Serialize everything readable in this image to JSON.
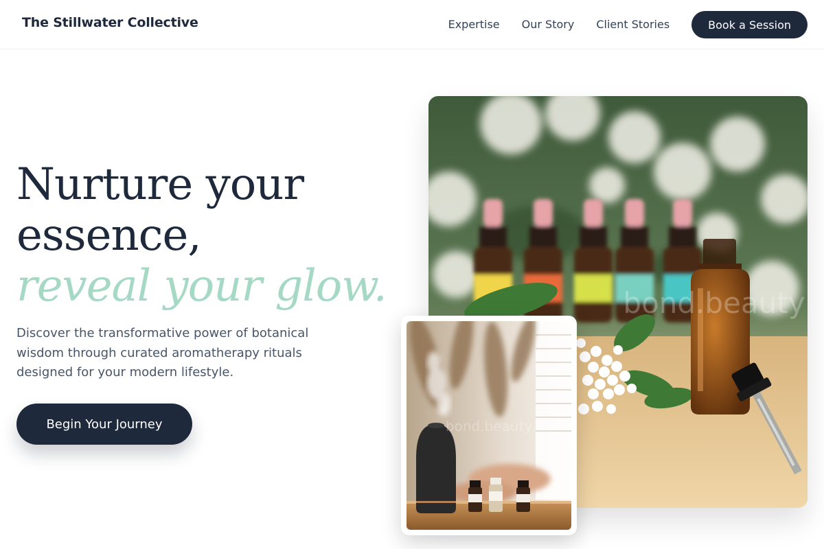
{
  "header": {
    "brand": "The Stillwater Collective",
    "nav": [
      {
        "label": "Expertise"
      },
      {
        "label": "Our Story"
      },
      {
        "label": "Client Stories"
      }
    ],
    "cta_label": "Book a Session"
  },
  "hero": {
    "title_line1": "Nurture your",
    "title_line2": "essence,",
    "title_accent": "reveal your glow.",
    "description": "Discover the transformative power of botanical wisdom through curated aromatherapy rituals designed for your modern lifestyle.",
    "cta_label": "Begin Your Journey"
  },
  "images": {
    "main_watermark": "bond.beauty",
    "small_watermark": "bond.beauty"
  },
  "colors": {
    "primary_dark": "#1e293b",
    "accent_mint": "#a6d9c5",
    "body_text": "#475569"
  }
}
